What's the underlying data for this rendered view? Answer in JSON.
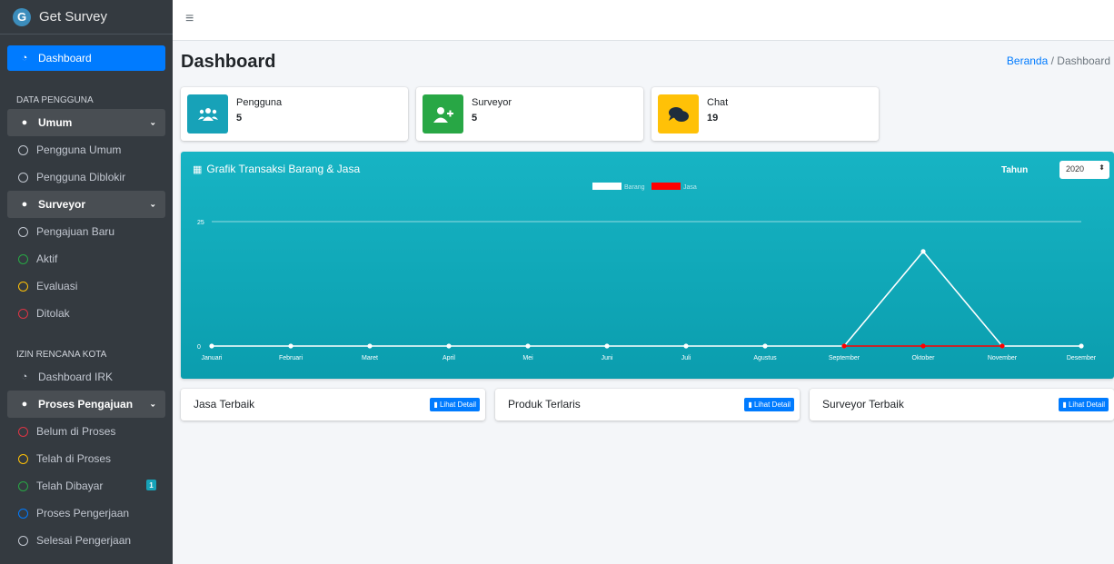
{
  "brand": {
    "name": "Get Survey",
    "logo_letter": "G"
  },
  "sidebar": {
    "dashboard": "Dashboard",
    "section1": "DATA PENGGUNA",
    "umum": "Umum",
    "pengguna_umum": "Pengguna Umum",
    "pengguna_diblokir": "Pengguna Diblokir",
    "surveyor": "Surveyor",
    "pengajuan_baru": "Pengajuan Baru",
    "aktif": "Aktif",
    "evaluasi": "Evaluasi",
    "ditolak": "Ditolak",
    "section2": "IZIN RENCANA KOTA",
    "dashboard_irk": "Dashboard IRK",
    "proses_pengajuan": "Proses Pengajuan",
    "belum_di_proses": "Belum di Proses",
    "telah_di_proses": "Telah di Proses",
    "telah_dibayar": "Telah Dibayar",
    "telah_dibayar_badge": "1",
    "proses_pengerjaan": "Proses Pengerjaan",
    "selesai_pengerjaan": "Selesai Pengerjaan"
  },
  "page": {
    "title": "Dashboard",
    "breadcrumb_home": "Beranda",
    "breadcrumb_current": "Dashboard"
  },
  "stats": [
    {
      "label": "Pengguna",
      "value": "5",
      "color": "#17a2b8"
    },
    {
      "label": "Surveyor",
      "value": "5",
      "color": "#28a745"
    },
    {
      "label": "Chat",
      "value": "19",
      "color": "#ffc107"
    }
  ],
  "chart_panel": {
    "title": "Grafik Transaksi Barang & Jasa",
    "year_label": "Tahun",
    "year_value": "2020"
  },
  "bottom": {
    "jasa": "Jasa Terbaik",
    "produk": "Produk Terlaris",
    "surveyor": "Surveyor Terbaik",
    "detail_label": "Lihat Detail"
  },
  "chart_data": {
    "type": "line",
    "categories": [
      "Januari",
      "Februari",
      "Maret",
      "April",
      "Mei",
      "Juni",
      "Juli",
      "Agustus",
      "September",
      "Oktober",
      "November",
      "Desember"
    ],
    "series": [
      {
        "name": "Barang",
        "color": "#ffffff",
        "values": [
          0,
          0,
          0,
          0,
          0,
          0,
          0,
          0,
          0,
          19,
          0,
          0
        ]
      },
      {
        "name": "Jasa",
        "color": "#ff0000",
        "values": [
          null,
          null,
          null,
          null,
          null,
          null,
          null,
          null,
          0,
          0,
          0,
          null
        ]
      }
    ],
    "ylim": [
      0,
      25
    ],
    "yticks": [
      "0",
      "25"
    ],
    "legend": "top-center"
  }
}
